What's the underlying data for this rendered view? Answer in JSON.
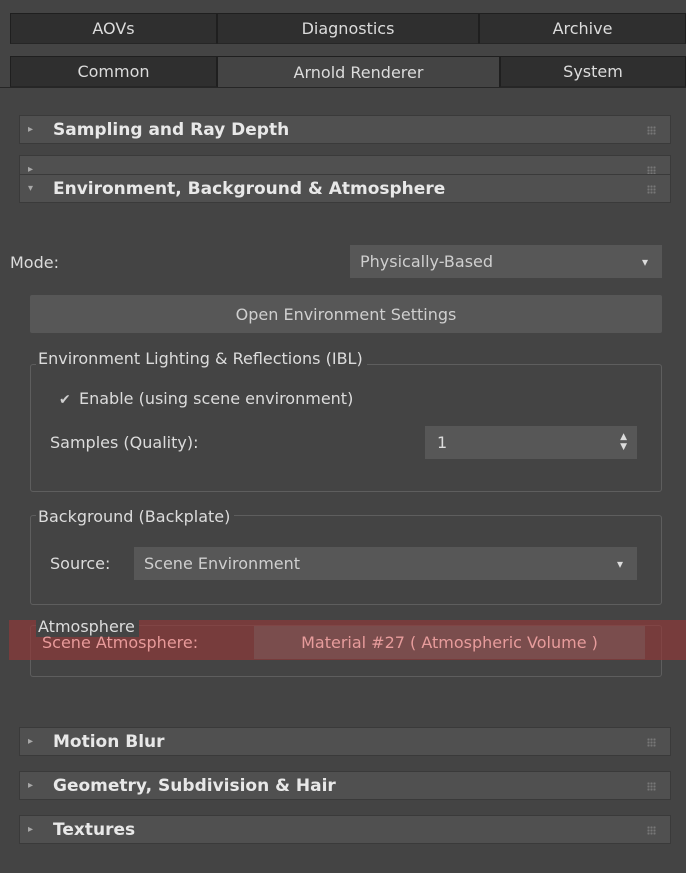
{
  "tabs_top": [
    "AOVs",
    "Diagnostics",
    "Archive"
  ],
  "tabs_bottom": [
    "Common",
    "Arnold Renderer",
    "System"
  ],
  "rollouts": {
    "sampling": "Sampling and Ray Depth",
    "empty": "",
    "environment": "Environment, Background & Atmosphere",
    "motion_blur": "Motion Blur",
    "geometry": "Geometry, Subdivision & Hair",
    "textures": "Textures"
  },
  "environment": {
    "mode_label": "Mode:",
    "mode_value": "Physically-Based",
    "open_settings_button": "Open Environment Settings",
    "ibl": {
      "legend": "Environment Lighting & Reflections (IBL)",
      "enable_label": "Enable (using scene environment)",
      "enable_checked": true,
      "samples_label": "Samples (Quality):",
      "samples_value": "1"
    },
    "background": {
      "legend": "Background (Backplate)",
      "source_label": "Source:",
      "source_value": "Scene Environment"
    },
    "atmosphere": {
      "legend": "Atmosphere",
      "scene_atmosphere_label": "Scene Atmosphere:",
      "scene_atmosphere_value": "Material #27  ( Atmospheric Volume )"
    }
  },
  "icons": {
    "collapsed": "▸",
    "expanded": "▾",
    "dropdown": "▾",
    "check": "✔",
    "spin_up": "▲",
    "spin_down": "▼"
  },
  "colors": {
    "panel_bg": "#444444",
    "rollout_bg": "#505050",
    "field_bg": "#575757",
    "highlight": "#963737"
  }
}
